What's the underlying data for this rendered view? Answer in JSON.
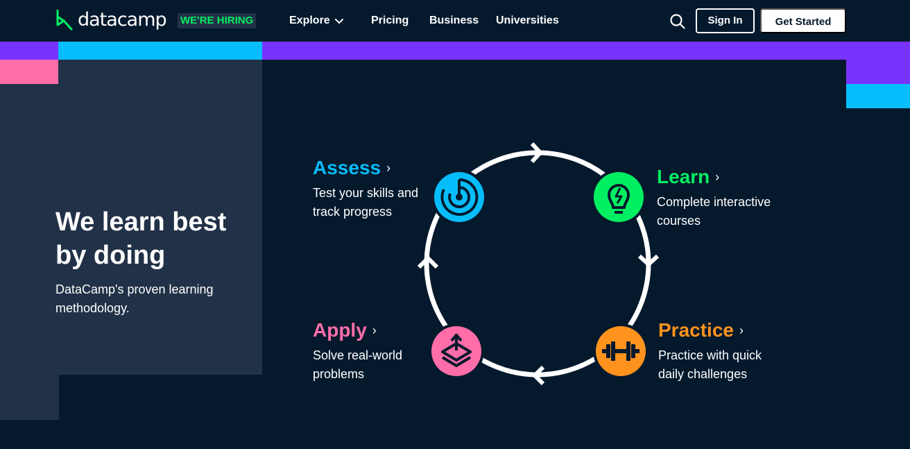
{
  "nav": {
    "logo_text": "datacamp",
    "hiring_badge": "WE'RE HIRING",
    "links": {
      "explore": "Explore",
      "pricing": "Pricing",
      "business": "Business",
      "universities": "Universities"
    },
    "sign_in": "Sign In",
    "get_started": "Get Started"
  },
  "hero": {
    "title": "We learn best by doing",
    "subtitle": "DataCamp's proven learning methodology."
  },
  "steps": {
    "assess": {
      "title": "Assess",
      "desc": "Test your skills and track progress",
      "color": "#06bdfc",
      "icon": "radar-icon"
    },
    "learn": {
      "title": "Learn",
      "desc": "Complete interactive courses",
      "color": "#03ef62",
      "icon": "lightbulb-icon"
    },
    "practice": {
      "title": "Practice",
      "desc": "Practice with quick daily challenges",
      "color": "#ff931e",
      "icon": "dumbbell-icon"
    },
    "apply": {
      "title": "Apply",
      "desc": "Solve real-world problems",
      "color": "#ff6ea9",
      "icon": "layers-icon"
    }
  },
  "colors": {
    "background": "#05192d",
    "panel": "#213147",
    "purple": "#7933ff",
    "blue": "#06bdfc",
    "pink": "#ff6ea9",
    "green": "#03ef62"
  }
}
